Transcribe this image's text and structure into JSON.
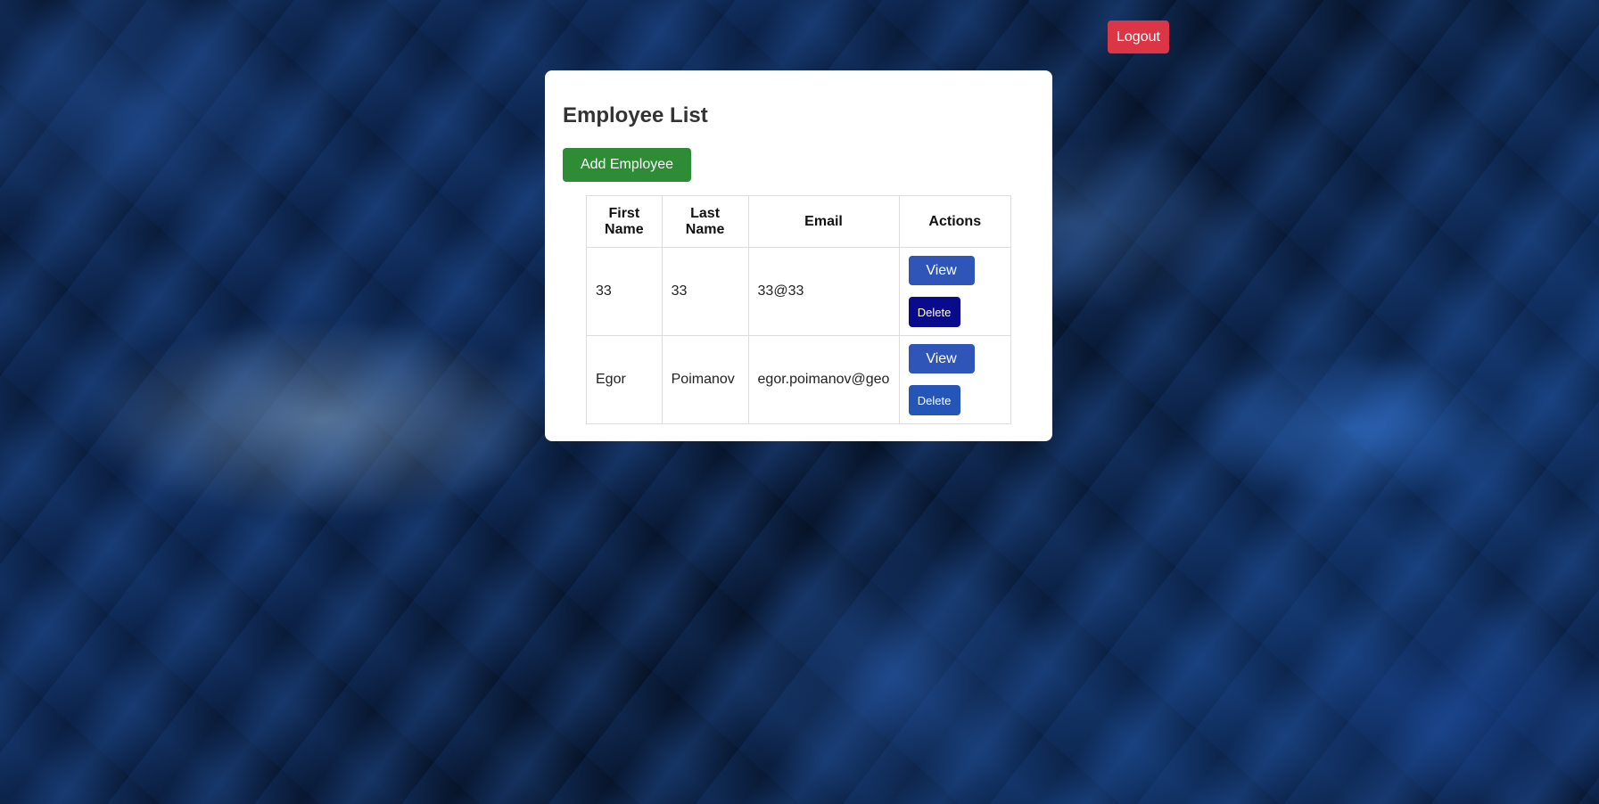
{
  "header": {
    "logout_label": "Logout",
    "logout_color": "#dc3545"
  },
  "main": {
    "title": "Employee List",
    "add_button_label": "Add Employee",
    "add_button_color": "#2e8b36"
  },
  "table": {
    "columns": [
      "First Name",
      "Last Name",
      "Email",
      "Actions"
    ],
    "rows": [
      {
        "first_name": "33",
        "last_name": "33",
        "email": "33@33",
        "view_label": "View",
        "delete_label": "Delete",
        "delete_color": "#0a0a8c"
      },
      {
        "first_name": "Egor",
        "last_name": "Poimanov",
        "email": "egor.poimanov@geo",
        "view_label": "View",
        "delete_label": "Delete",
        "delete_color": "#2456b8"
      }
    ]
  },
  "colors": {
    "view_button": "#2f55b8",
    "card_background": "#ffffff"
  }
}
